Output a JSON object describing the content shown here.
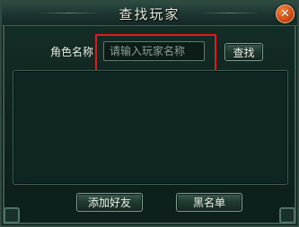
{
  "window": {
    "title": "查找玩家"
  },
  "search": {
    "label": "角色名称",
    "placeholder": "请输入玩家名称",
    "find_label": "查找"
  },
  "footer": {
    "add_friend_label": "添加好友",
    "blacklist_label": "黑名单"
  },
  "icons": {
    "close": "close-icon"
  },
  "colors": {
    "highlight": "#e2191f",
    "close_button": "#e2561a"
  }
}
